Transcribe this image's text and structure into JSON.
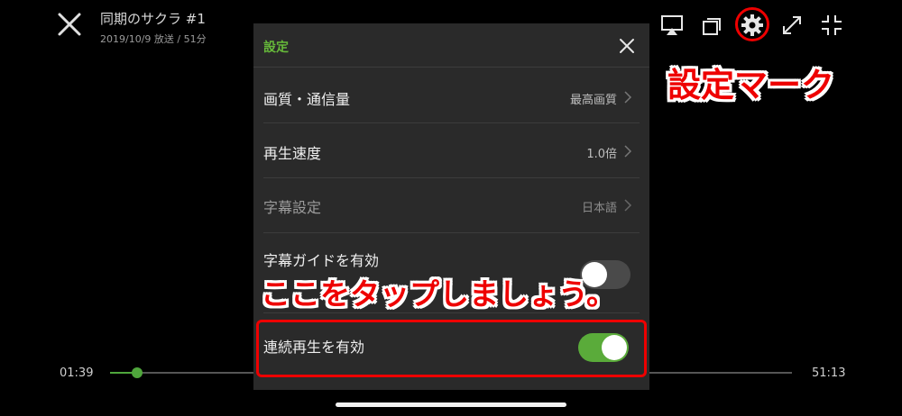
{
  "player": {
    "title": "同期のサクラ #1",
    "subtitle": "2019/10/9 放送 / 51分",
    "time_elapsed": "01:39",
    "time_total": "51:13",
    "progress": 0.04
  },
  "toolbar": {
    "icons": [
      "airplay-icon",
      "multi-window-icon",
      "gear-icon",
      "expand-icon",
      "shrink-icon"
    ]
  },
  "settings": {
    "title": "設定",
    "rows": [
      {
        "label": "画質・通信量",
        "value": "最高画質"
      },
      {
        "label": "再生速度",
        "value": "1.0倍"
      },
      {
        "label": "字幕設定",
        "value": "日本語"
      }
    ],
    "subtitle_guide": {
      "label": "字幕ガイドを有効",
      "on": false
    },
    "continuous_play": {
      "label": "連続再生を有効",
      "on": true
    }
  },
  "annotations": {
    "gear_note": "設定マーク",
    "tap_note": "ここをタップしましょう。"
  },
  "colors": {
    "accent": "#66b93a",
    "toggle_on": "#5aab3a",
    "annotation": "#e00000"
  }
}
